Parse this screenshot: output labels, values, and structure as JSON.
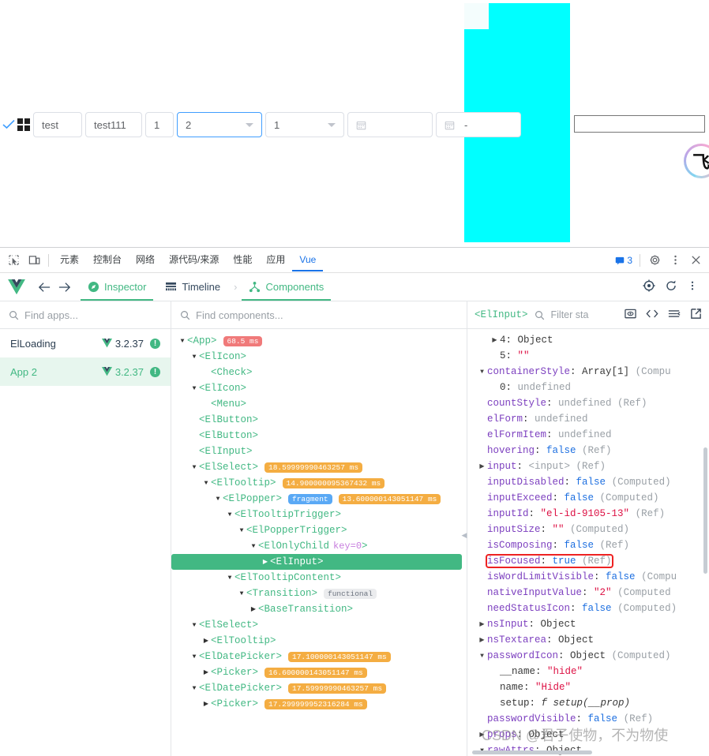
{
  "app_under_test": {
    "controls": [
      {
        "kind": "check-icon",
        "label": ""
      },
      {
        "kind": "grid-icon",
        "label": ""
      },
      {
        "kind": "input",
        "value": "test"
      },
      {
        "kind": "input",
        "value": "test111"
      },
      {
        "kind": "input",
        "value": "1"
      },
      {
        "kind": "select",
        "value": "2",
        "focused": true
      },
      {
        "kind": "select",
        "value": "1",
        "focused": false
      },
      {
        "kind": "datepicker",
        "value": ""
      },
      {
        "kind": "daterange",
        "value": "",
        "separator": "-"
      }
    ],
    "plain_input_value": "",
    "logo_glyph": "飞"
  },
  "devtools": {
    "tabs": [
      {
        "label": "元素",
        "active": false
      },
      {
        "label": "控制台",
        "active": false
      },
      {
        "label": "网络",
        "active": false
      },
      {
        "label": "源代码/来源",
        "active": false
      },
      {
        "label": "性能",
        "active": false
      },
      {
        "label": "应用",
        "active": false
      },
      {
        "label": "Vue",
        "active": true
      }
    ],
    "issues_count": "3",
    "left_icons": [
      "inspect-element-icon",
      "device-toolbar-icon"
    ],
    "right_icons": [
      "issues-icon",
      "settings-gear-icon",
      "more-options-icon",
      "close-icon"
    ]
  },
  "vue_header": {
    "logo": "vue-logo-icon",
    "back": "back-arrow-icon",
    "forward": "forward-arrow-icon",
    "items": [
      {
        "label": "Inspector",
        "icon": "compass-icon",
        "active": true
      },
      {
        "label": "Timeline",
        "icon": "timeline-icon",
        "active": false
      }
    ],
    "breadcrumb_chevron": "›",
    "current": {
      "label": "Components",
      "icon": "components-tree-icon",
      "active": true
    },
    "right_icons": [
      "target-select-icon",
      "refresh-icon",
      "more-vertical-icon"
    ]
  },
  "apps_pane": {
    "search_placeholder": "Find apps...",
    "items": [
      {
        "name": "ElLoading",
        "version": "3.2.37",
        "selected": false,
        "badge": "!"
      },
      {
        "name": "App 2",
        "version": "3.2.37",
        "selected": true,
        "badge": "!"
      }
    ]
  },
  "tree_pane": {
    "search_placeholder": "Find components...",
    "nodes": [
      {
        "depth": 0,
        "arrow": "down",
        "name": "<App>",
        "badges": [
          {
            "text": "68.5 ms",
            "style": "red"
          }
        ]
      },
      {
        "depth": 1,
        "arrow": "down",
        "name": "<ElIcon>",
        "badges": []
      },
      {
        "depth": 2,
        "arrow": "none",
        "name": "<Check>",
        "badges": []
      },
      {
        "depth": 1,
        "arrow": "down",
        "name": "<ElIcon>",
        "badges": []
      },
      {
        "depth": 2,
        "arrow": "none",
        "name": "<Menu>",
        "badges": []
      },
      {
        "depth": 1,
        "arrow": "none",
        "name": "<ElButton>",
        "badges": []
      },
      {
        "depth": 1,
        "arrow": "none",
        "name": "<ElButton>",
        "badges": []
      },
      {
        "depth": 1,
        "arrow": "none",
        "name": "<ElInput>",
        "badges": []
      },
      {
        "depth": 1,
        "arrow": "down",
        "name": "<ElSelect>",
        "badges": [
          {
            "text": "18.59999990463257 ms",
            "style": "orange"
          }
        ]
      },
      {
        "depth": 2,
        "arrow": "down",
        "name": "<ElTooltip>",
        "badges": [
          {
            "text": "14.900000095367432 ms",
            "style": "orange"
          }
        ]
      },
      {
        "depth": 3,
        "arrow": "down",
        "name": "<ElPopper>",
        "badges": [
          {
            "text": "fragment",
            "style": "blue"
          },
          {
            "text": "13.600000143051147 ms",
            "style": "orange"
          }
        ]
      },
      {
        "depth": 4,
        "arrow": "down",
        "name": "<ElTooltipTrigger>",
        "badges": []
      },
      {
        "depth": 5,
        "arrow": "down",
        "name": "<ElPopperTrigger>",
        "badges": []
      },
      {
        "depth": 6,
        "arrow": "down",
        "name": "<ElOnlyChild",
        "key": "key=0",
        "close": ">",
        "badges": []
      },
      {
        "depth": 7,
        "arrow": "right",
        "name": "<ElInput>",
        "selected": true,
        "badges": []
      },
      {
        "depth": 4,
        "arrow": "down",
        "name": "<ElTooltipContent>",
        "badges": []
      },
      {
        "depth": 5,
        "arrow": "down",
        "name": "<Transition>",
        "badges": [
          {
            "text": "functional",
            "style": "grey"
          }
        ]
      },
      {
        "depth": 6,
        "arrow": "right",
        "name": "<BaseTransition>",
        "badges": []
      },
      {
        "depth": 1,
        "arrow": "down",
        "name": "<ElSelect>",
        "badges": []
      },
      {
        "depth": 2,
        "arrow": "right",
        "name": "<ElTooltip>",
        "badges": []
      },
      {
        "depth": 1,
        "arrow": "down",
        "name": "<ElDatePicker>",
        "badges": [
          {
            "text": "17.100000143051147 ms",
            "style": "orange"
          }
        ]
      },
      {
        "depth": 2,
        "arrow": "right",
        "name": "<Picker>",
        "badges": [
          {
            "text": "16.600000143051147 ms",
            "style": "orange"
          }
        ]
      },
      {
        "depth": 1,
        "arrow": "down",
        "name": "<ElDatePicker>",
        "badges": [
          {
            "text": "17.59999990463257 ms",
            "style": "orange"
          }
        ]
      },
      {
        "depth": 2,
        "arrow": "right",
        "name": "<Picker>",
        "badges": [
          {
            "text": "17.299999952316284 ms",
            "style": "orange"
          }
        ]
      }
    ]
  },
  "props_pane": {
    "component": "<ElInput>",
    "filter_placeholder": "Filter sta",
    "icons": [
      "inspect-dom-icon",
      "open-in-editor-icon",
      "collapse-all-icon",
      "open-external-icon"
    ],
    "rows": [
      {
        "indent": 1,
        "arrow": "right",
        "key": "4",
        "keyStyle": "plain",
        "value": "Object",
        "valueStyle": "obj"
      },
      {
        "indent": 1,
        "arrow": "none",
        "key": "5",
        "keyStyle": "plain",
        "value": "\"\"",
        "valueStyle": "str"
      },
      {
        "indent": 0,
        "arrow": "down",
        "key": "containerStyle",
        "keyStyle": "key",
        "value": "Array[1]",
        "valueStyle": "obj",
        "meta": "(Compu"
      },
      {
        "indent": 1,
        "arrow": "none",
        "key": "0",
        "keyStyle": "plain",
        "value": "undefined",
        "valueStyle": "undef"
      },
      {
        "indent": 0,
        "arrow": "none",
        "key": "countStyle",
        "keyStyle": "key",
        "value": "undefined",
        "valueStyle": "undef",
        "meta": "(Ref)"
      },
      {
        "indent": 0,
        "arrow": "none",
        "key": "elForm",
        "keyStyle": "key",
        "value": "undefined",
        "valueStyle": "undef"
      },
      {
        "indent": 0,
        "arrow": "none",
        "key": "elFormItem",
        "keyStyle": "key",
        "value": "undefined",
        "valueStyle": "undef"
      },
      {
        "indent": 0,
        "arrow": "none",
        "key": "hovering",
        "keyStyle": "key",
        "value": "false",
        "valueStyle": "bool",
        "meta": "(Ref)"
      },
      {
        "indent": 0,
        "arrow": "right",
        "key": "input",
        "keyStyle": "key",
        "value": "<input>",
        "valueStyle": "tag",
        "meta": "(Ref)"
      },
      {
        "indent": 0,
        "arrow": "none",
        "key": "inputDisabled",
        "keyStyle": "key",
        "value": "false",
        "valueStyle": "bool",
        "meta": "(Computed)"
      },
      {
        "indent": 0,
        "arrow": "none",
        "key": "inputExceed",
        "keyStyle": "key",
        "value": "false",
        "valueStyle": "bool",
        "meta": "(Computed)"
      },
      {
        "indent": 0,
        "arrow": "none",
        "key": "inputId",
        "keyStyle": "key",
        "value": "\"el-id-9105-13\"",
        "valueStyle": "str",
        "meta": "(Ref)"
      },
      {
        "indent": 0,
        "arrow": "none",
        "key": "inputSize",
        "keyStyle": "key",
        "value": "\"\"",
        "valueStyle": "str",
        "meta": "(Computed)"
      },
      {
        "indent": 0,
        "arrow": "none",
        "key": "isComposing",
        "keyStyle": "key",
        "value": "false",
        "valueStyle": "bool",
        "meta": "(Ref)"
      },
      {
        "indent": 0,
        "arrow": "none",
        "key": "isFocused",
        "keyStyle": "key",
        "value": "true",
        "valueStyle": "bool",
        "meta": "(Ref)",
        "highlight": true
      },
      {
        "indent": 0,
        "arrow": "none",
        "key": "isWordLimitVisible",
        "keyStyle": "key",
        "value": "false",
        "valueStyle": "bool",
        "meta": "(Compu"
      },
      {
        "indent": 0,
        "arrow": "none",
        "key": "nativeInputValue",
        "keyStyle": "key",
        "value": "\"2\"",
        "valueStyle": "str",
        "meta": "(Computed"
      },
      {
        "indent": 0,
        "arrow": "none",
        "key": "needStatusIcon",
        "keyStyle": "key",
        "value": "false",
        "valueStyle": "bool",
        "meta": "(Computed)"
      },
      {
        "indent": 0,
        "arrow": "right",
        "key": "nsInput",
        "keyStyle": "key",
        "value": "Object",
        "valueStyle": "obj"
      },
      {
        "indent": 0,
        "arrow": "right",
        "key": "nsTextarea",
        "keyStyle": "key",
        "value": "Object",
        "valueStyle": "obj"
      },
      {
        "indent": 0,
        "arrow": "down",
        "key": "passwordIcon",
        "keyStyle": "key",
        "value": "Object",
        "valueStyle": "obj",
        "meta": "(Computed)"
      },
      {
        "indent": 1,
        "arrow": "none",
        "key": "__name",
        "keyStyle": "plain",
        "value": "\"hide\"",
        "valueStyle": "str"
      },
      {
        "indent": 1,
        "arrow": "none",
        "key": "name",
        "keyStyle": "plain",
        "value": "\"Hide\"",
        "valueStyle": "str"
      },
      {
        "indent": 1,
        "arrow": "none",
        "key": "setup",
        "keyStyle": "plain",
        "value": "f setup(__prop)",
        "valueStyle": "fn"
      },
      {
        "indent": 0,
        "arrow": "none",
        "key": "passwordVisible",
        "keyStyle": "key",
        "value": "false",
        "valueStyle": "bool",
        "meta": "(Ref)"
      },
      {
        "indent": 0,
        "arrow": "right",
        "key": "props",
        "keyStyle": "key",
        "value": "Object",
        "valueStyle": "obj"
      },
      {
        "indent": 0,
        "arrow": "down",
        "key": "rawAttrs",
        "keyStyle": "key",
        "value": "Object",
        "valueStyle": "obj"
      }
    ]
  },
  "watermark": "CSDN @君子使物，不为物使",
  "colors": {
    "vue_green": "#42b883",
    "chrome_blue": "#1a73e8",
    "cyan_block": "#00ffff",
    "badge_red": "#f07a7a",
    "badge_orange": "#f4ad42",
    "badge_blue": "#5aa9f5",
    "highlight_red": "#ee2222"
  }
}
